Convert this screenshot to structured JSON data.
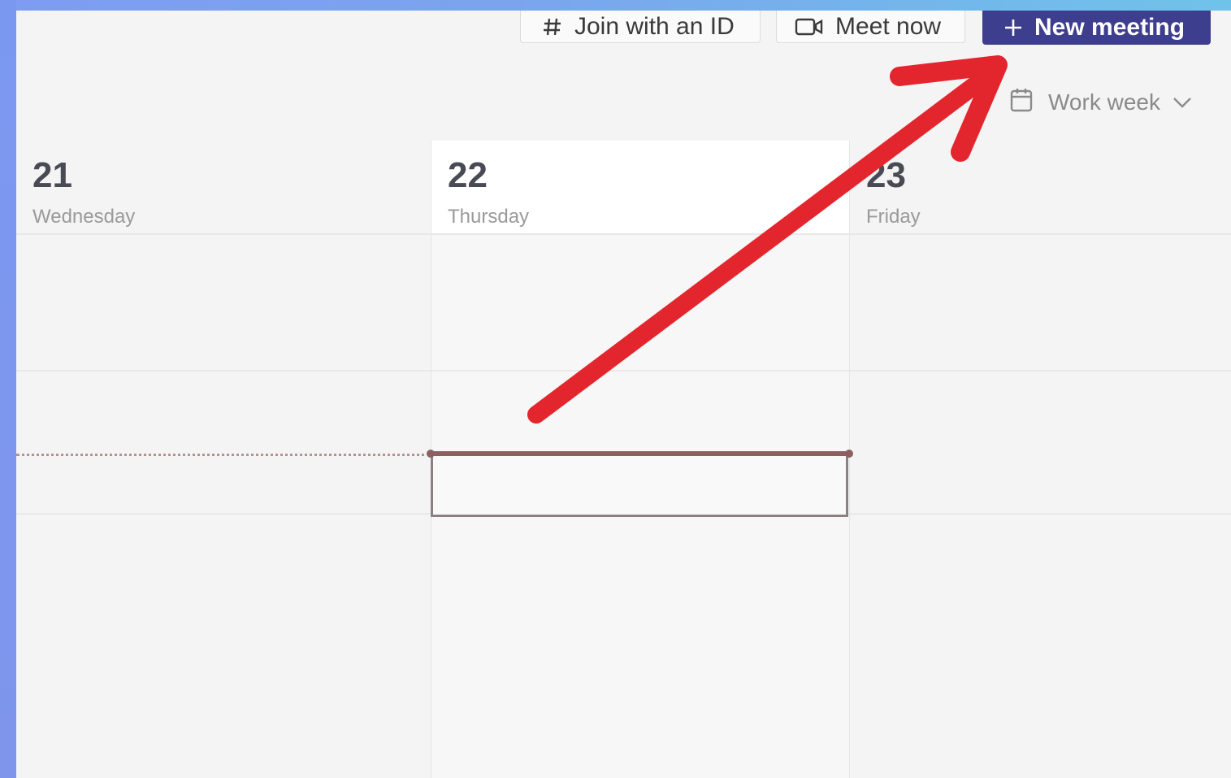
{
  "toolbar": {
    "join_label": "Join with an ID",
    "meet_label": "Meet now",
    "new_meeting_label": "New meeting"
  },
  "view": {
    "label": "Work week"
  },
  "days": [
    {
      "number": "21",
      "name": "Wednesday"
    },
    {
      "number": "22",
      "name": "Thursday"
    },
    {
      "number": "23",
      "name": "Friday"
    }
  ],
  "colors": {
    "primary_button": "#3e3e8e",
    "annotation_arrow": "#e3262e",
    "current_time_line": "#8c6060"
  },
  "icons": {
    "join": "hash-icon",
    "meet": "video-icon",
    "new": "plus-icon",
    "view": "calendar-icon",
    "dropdown": "chevron-down-icon"
  }
}
